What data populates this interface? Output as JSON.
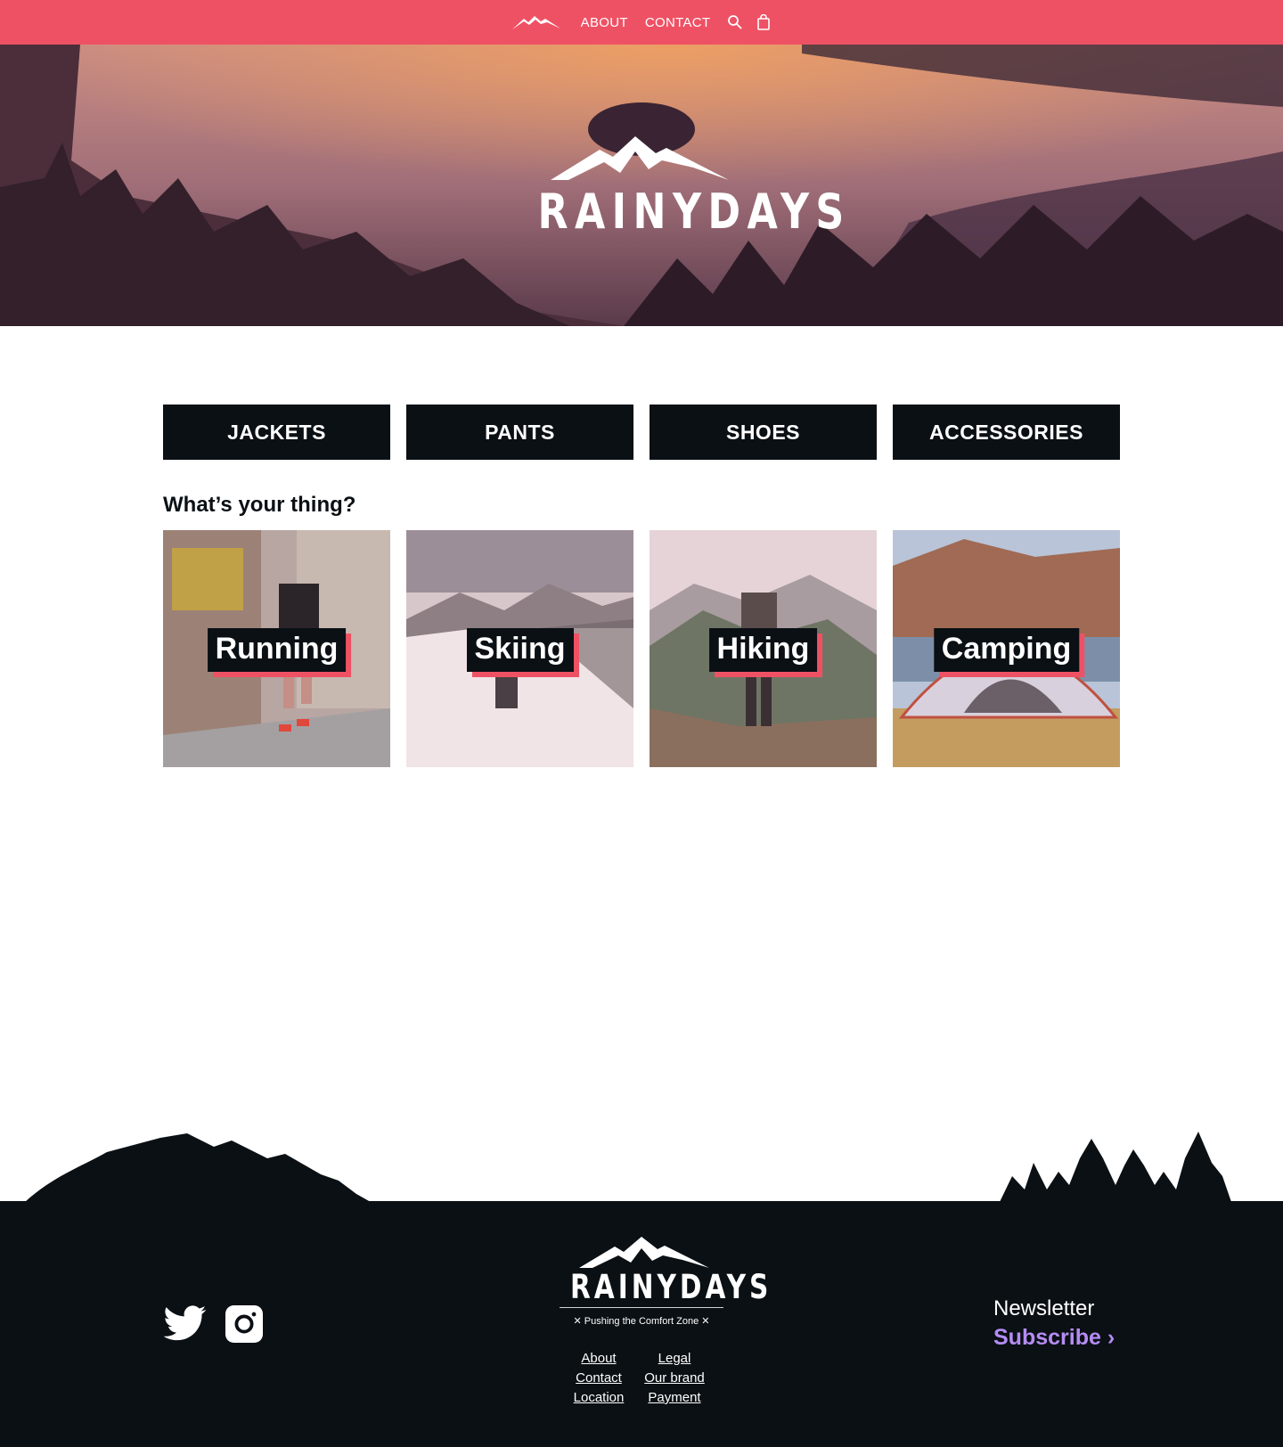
{
  "colors": {
    "nav": "#ef5164",
    "dark": "#0a1014",
    "accent": "#ef5164",
    "subscribe": "#b58cf3"
  },
  "nav": {
    "logo_icon": "mountain-icon",
    "links": [
      "ABOUT",
      "CONTACT"
    ],
    "search_icon": "search-icon",
    "cart_icon": "shopping-bag-icon"
  },
  "hero": {
    "logo_text": "RAINYDAYS"
  },
  "categories": [
    "JACKETS",
    "PANTS",
    "SHOES",
    "ACCESSORIES"
  ],
  "section_title": "What’s your thing?",
  "activities": [
    "Running",
    "Skiing",
    "Hiking",
    "Camping"
  ],
  "footer": {
    "social": [
      "twitter-icon",
      "instagram-icon"
    ],
    "logo_text": "RAINYDAYS",
    "tagline": "✕ Pushing the Comfort Zone ✕",
    "links": [
      "About",
      "Legal",
      "Contact",
      "Our brand",
      "Location",
      "Payment"
    ],
    "newsletter_title": "Newsletter",
    "subscribe": "Subscribe ›"
  }
}
